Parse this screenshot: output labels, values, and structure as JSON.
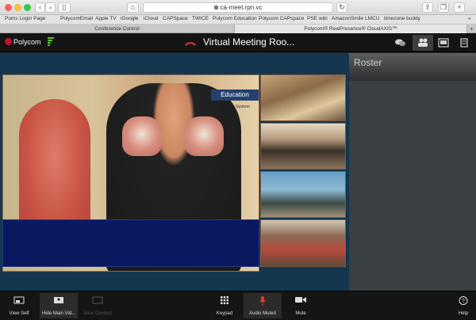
{
  "browser": {
    "url": "ca-meet.rpn.vc",
    "bookmarks": [
      "Poms Login Page",
      "PolycomEmail",
      "Apple TV",
      "iGoogle",
      "iCloud",
      "CAPSpace",
      "TWICE",
      "Polycom Education",
      "Polycom CAPspace",
      "PSE wiki",
      "AmazonSmile",
      "LMCU",
      "timezone buddy"
    ],
    "tabs": [
      "Conference Control",
      "Polycom® RealPresence® CloudAXIS™"
    ],
    "overflow": "»"
  },
  "app": {
    "logo_text": "Polycom",
    "meeting_title": "Virtual Meeting Roo...",
    "roster_title": "Roster",
    "accent": "#c8102e",
    "signal_color": "#5bc236"
  },
  "toolbar": {
    "view_self": "View Self",
    "hide_main": "Hide Main Vid...",
    "view_content": "View Content",
    "keypad": "Keypad",
    "audio_muted": "Audio Muted",
    "mute": "Mute",
    "help": "Help"
  },
  "video": {
    "overlay_text": "Education",
    "overlay_text2": "System"
  }
}
